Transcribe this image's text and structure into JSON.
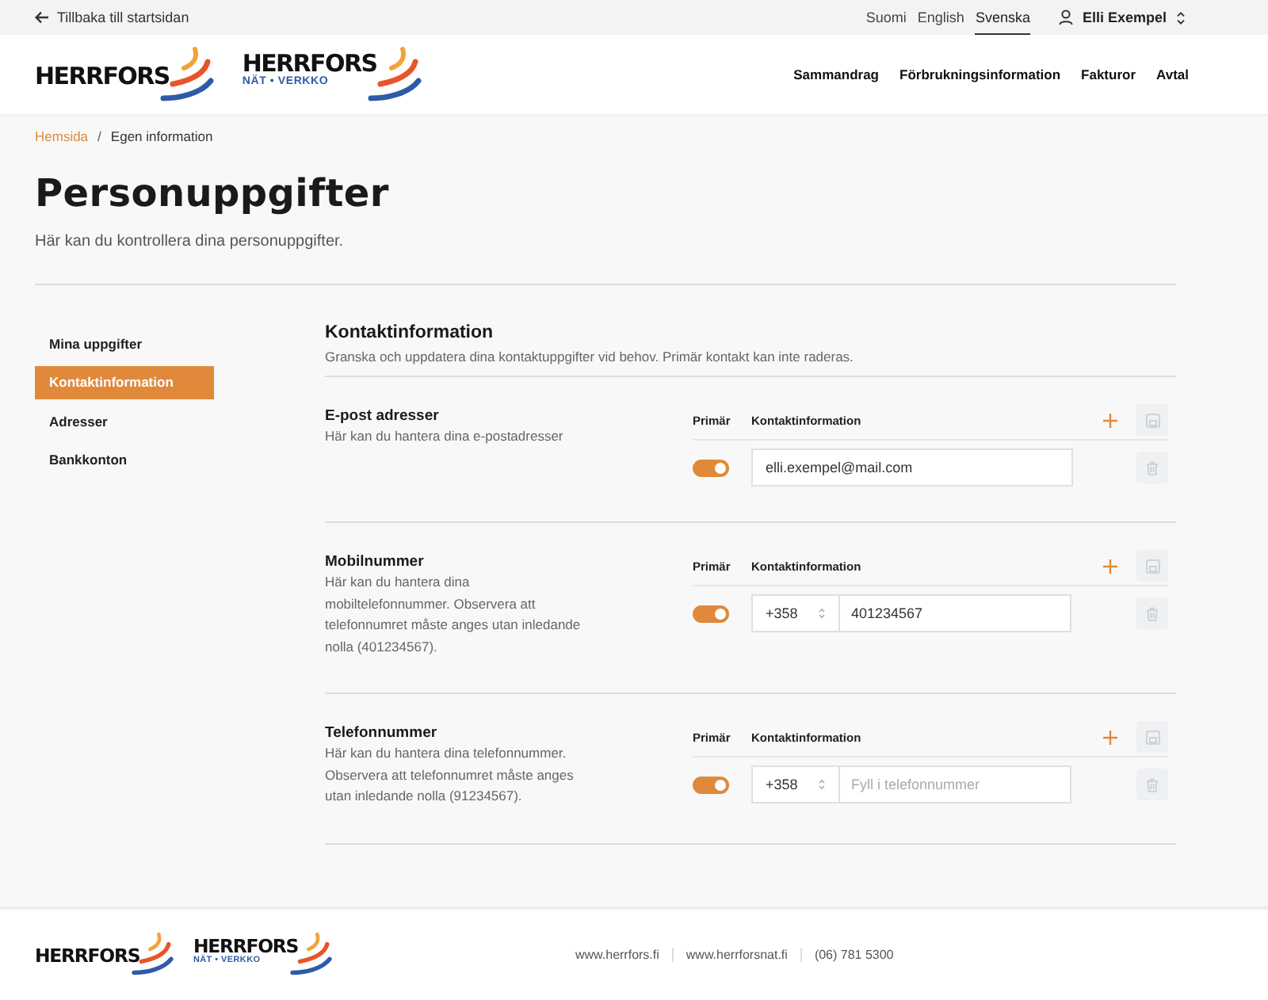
{
  "top_bar": {
    "back_link": "Tillbaka till startsidan",
    "languages": [
      {
        "label": "Suomi",
        "selected": false
      },
      {
        "label": "English",
        "selected": false
      },
      {
        "label": "Svenska",
        "selected": true
      }
    ],
    "user": "Elli Exempel"
  },
  "header": {
    "logos": [
      {
        "name": "HERRFORS"
      },
      {
        "name": "HERRFORS",
        "subtitle": "NÄT • VERKKO"
      }
    ],
    "nav": [
      "Sammandrag",
      "Förbrukningsinformation",
      "Fakturor",
      "Avtal"
    ]
  },
  "breadcrumb": [
    {
      "label": "Hemsida",
      "kind": "link"
    },
    {
      "label": "Egen information",
      "kind": "current"
    }
  ],
  "breadcrumb_separator": "/",
  "page": {
    "title": "Personuppgifter",
    "subtitle": "Här kan du kontrollera dina personuppgifter."
  },
  "sidebar": {
    "items": [
      {
        "label": "Mina uppgifter",
        "selected": false
      },
      {
        "label": "Kontaktinformation",
        "selected": true
      },
      {
        "label": "Adresser",
        "selected": false
      },
      {
        "label": "Bankkonton",
        "selected": false
      }
    ]
  },
  "content": {
    "title": "Kontaktinformation",
    "description": "Granska och uppdatera dina kontaktuppgifter vid behov. Primär kontakt kan inte raderas.",
    "sections": [
      {
        "kind": "email",
        "title": "E-post adresser",
        "description": "Här kan du hantera dina e-postadresser",
        "columns": [
          "Primär",
          "Kontaktinformation"
        ],
        "rows": [
          {
            "primary": true,
            "value": "elli.exempel@mail.com"
          }
        ]
      },
      {
        "kind": "phone",
        "title": "Mobilnummer",
        "description": "Här kan du hantera dina mobiltelefonnummer. Observera att telefonnumret måste anges utan inledande nolla (401234567).",
        "columns": [
          "Primär",
          "Kontaktinformation"
        ],
        "rows": [
          {
            "primary": true,
            "country_code": "+358",
            "value": "401234567"
          }
        ]
      },
      {
        "kind": "phone",
        "title": "Telefonnummer",
        "description": "Här kan du hantera dina telefonnummer. Observera att telefonnumret måste anges utan inledande nolla (91234567).",
        "columns": [
          "Primär",
          "Kontaktinformation"
        ],
        "rows": [
          {
            "primary": true,
            "country_code": "+358",
            "placeholder": "Fyll i telefonnummer"
          }
        ]
      }
    ]
  },
  "footer": {
    "logos": [
      {
        "name": "HERRFORS"
      },
      {
        "name": "HERRFORS",
        "subtitle": "NÄT • VERKKO"
      }
    ],
    "links": [
      "www.herrfors.fi",
      "www.herrforsnat.fi",
      "(06) 781 5300"
    ]
  }
}
